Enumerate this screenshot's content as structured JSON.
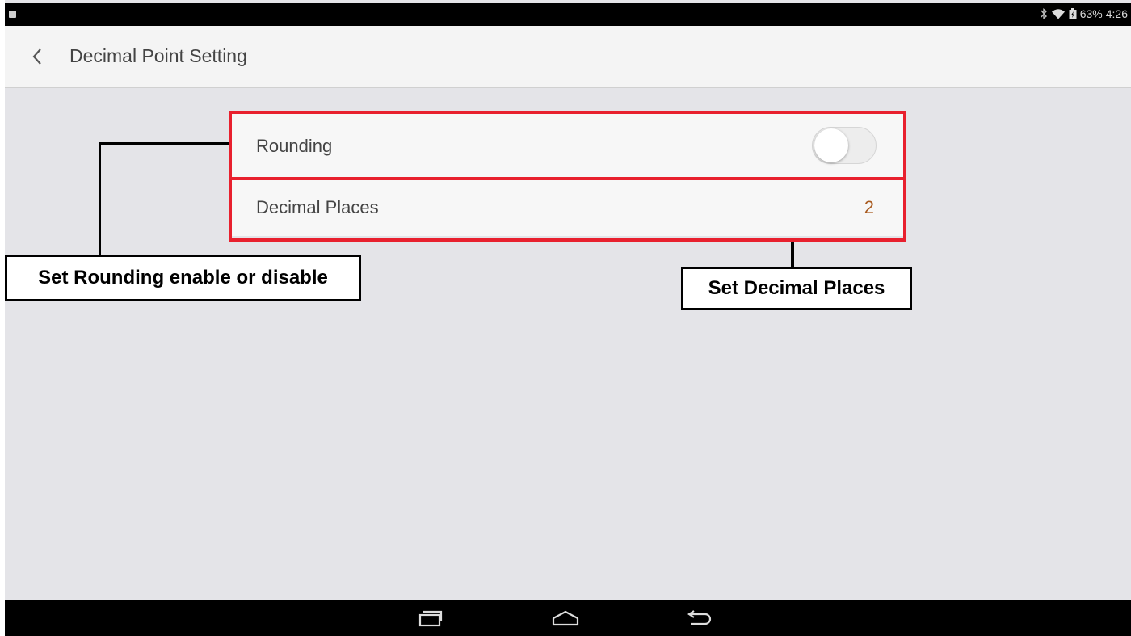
{
  "status_bar": {
    "battery": "63%",
    "time": "4:26",
    "icons": [
      "app-notification-icon",
      "bluetooth-icon",
      "wifi-icon",
      "battery-icon"
    ]
  },
  "app_bar": {
    "back_icon": "chevron-left-icon",
    "title": "Decimal Point Setting"
  },
  "settings": {
    "rounding": {
      "label": "Rounding",
      "enabled": false
    },
    "decimal_places": {
      "label": "Decimal Places",
      "value": "2"
    }
  },
  "annotations": {
    "rounding_callout": "Set Rounding enable or disable",
    "decimal_callout": "Set Decimal Places",
    "highlight_color": "#e8202e"
  },
  "nav_bar": {
    "icons": [
      "recent-apps-icon",
      "home-icon",
      "back-icon"
    ]
  },
  "colors": {
    "value_accent": "#a85a1e",
    "background": "#e4e4e8"
  }
}
